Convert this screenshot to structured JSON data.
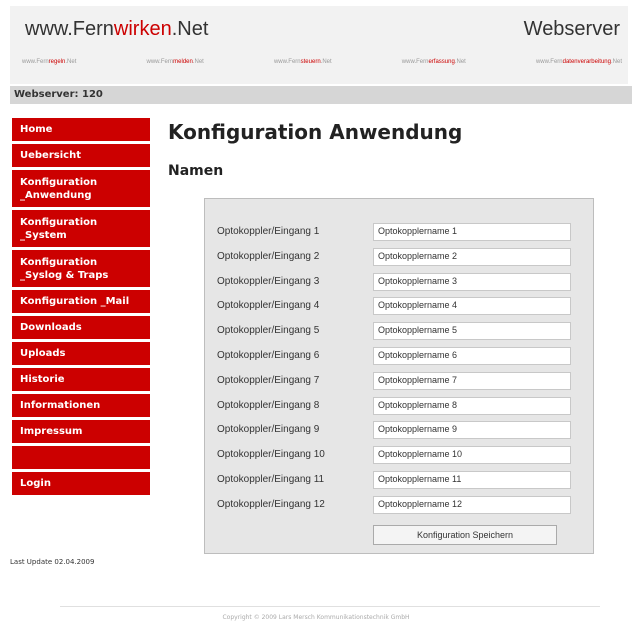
{
  "header": {
    "site_title_pre": "www.Fern",
    "site_title_red": "wirken",
    "site_title_post": ".Net",
    "server_title": "Webserver",
    "subnav": [
      {
        "pre": "www.Fern",
        "red": "regeln",
        "post": ".Net"
      },
      {
        "pre": "www.Fern",
        "red": "melden",
        "post": ".Net"
      },
      {
        "pre": "www.Fern",
        "red": "steuern",
        "post": ".Net"
      },
      {
        "pre": "www.Fern",
        "red": "erfassung",
        "post": ".Net"
      },
      {
        "pre": "www.Fern",
        "red": "datenverarbeitung",
        "post": ".Net"
      }
    ]
  },
  "statusbar": {
    "label": "Webserver: 120"
  },
  "sidebar": {
    "items": [
      {
        "label": "Home",
        "h": 26
      },
      {
        "label": "Uebersicht",
        "h": 26
      },
      {
        "label": "Konfiguration\n_Anwendung",
        "h": 40
      },
      {
        "label": "Konfiguration\n_System",
        "h": 40
      },
      {
        "label": "Konfiguration\n_Syslog & Traps",
        "h": 40
      },
      {
        "label": "Konfiguration _Mail",
        "h": 26
      },
      {
        "label": "Downloads",
        "h": 26
      },
      {
        "label": "Uploads",
        "h": 26
      },
      {
        "label": "Historie",
        "h": 26
      },
      {
        "label": "Informationen",
        "h": 26
      },
      {
        "label": "Impressum",
        "h": 26
      },
      {
        "label": "",
        "h": 26
      },
      {
        "label": "Login",
        "h": 26
      }
    ],
    "last_update": "Last Update 02.04.2009"
  },
  "main": {
    "title": "Konfiguration Anwendung",
    "section": "Namen",
    "rows": [
      {
        "label": "Optokoppler/Eingang 1",
        "value": "Optokopplername 1"
      },
      {
        "label": "Optokoppler/Eingang 2",
        "value": "Optokopplername 2"
      },
      {
        "label": "Optokoppler/Eingang 3",
        "value": "Optokopplername 3"
      },
      {
        "label": "Optokoppler/Eingang 4",
        "value": "Optokopplername 4"
      },
      {
        "label": "Optokoppler/Eingang 5",
        "value": "Optokopplername 5"
      },
      {
        "label": "Optokoppler/Eingang 6",
        "value": "Optokopplername 6"
      },
      {
        "label": "Optokoppler/Eingang 7",
        "value": "Optokopplername 7"
      },
      {
        "label": "Optokoppler/Eingang 8",
        "value": "Optokopplername 8"
      },
      {
        "label": "Optokoppler/Eingang 9",
        "value": "Optokopplername 9"
      },
      {
        "label": "Optokoppler/Eingang 10",
        "value": "Optokopplername 10"
      },
      {
        "label": "Optokoppler/Eingang 11",
        "value": "Optokopplername 11"
      },
      {
        "label": "Optokoppler/Eingang 12",
        "value": "Optokopplername 12"
      }
    ],
    "save_label": "Konfiguration Speichern"
  },
  "footer": {
    "copyright": "Copyright © 2009 Lars Mersch Kommunikationstechnik GmbH"
  },
  "colors": {
    "accent": "#cc0000",
    "panel": "#e6e6e6",
    "statusbar": "#d6d6d6"
  }
}
